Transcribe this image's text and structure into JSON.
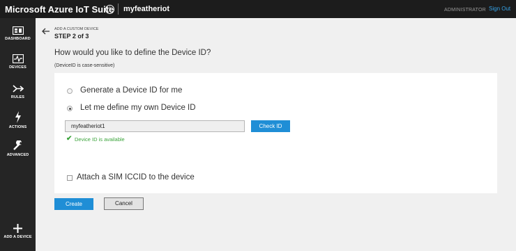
{
  "header": {
    "app_title": "Microsoft Azure IoT Suite",
    "info_glyph": "i",
    "solution_name": "myfeatheriot",
    "user_role": "ADMINISTRATOR",
    "sign_out": "Sign Out"
  },
  "sidebar": {
    "items": [
      {
        "label": "DASHBOARD",
        "icon": "dashboard-icon"
      },
      {
        "label": "DEVICES",
        "icon": "devices-icon"
      },
      {
        "label": "RULES",
        "icon": "rules-icon"
      },
      {
        "label": "ACTIONS",
        "icon": "actions-icon"
      },
      {
        "label": "ADVANCED",
        "icon": "advanced-icon"
      }
    ],
    "add_device": {
      "label": "ADD A DEVICE",
      "icon": "plus-icon"
    }
  },
  "wizard": {
    "subtitle": "ADD A CUSTOM DEVICE",
    "step": "STEP 2 of 3",
    "question": "How would you like to define the Device ID?",
    "note": "(DeviceID is case-sensitive)",
    "option_generate": "Generate a Device ID for me",
    "option_define": "Let me define my own Device ID",
    "selected_option": "define",
    "device_id_value": "myfeatheriot1",
    "check_button": "Check ID",
    "availability": "Device ID is available",
    "sim_label": "Attach a SIM ICCID to the device",
    "sim_checked": false
  },
  "footer": {
    "create": "Create",
    "cancel": "Cancel"
  },
  "colors": {
    "accent": "#1f8ed6",
    "success": "#3aa33a",
    "topbar": "#1c1c1c",
    "sidebar": "#252525"
  }
}
